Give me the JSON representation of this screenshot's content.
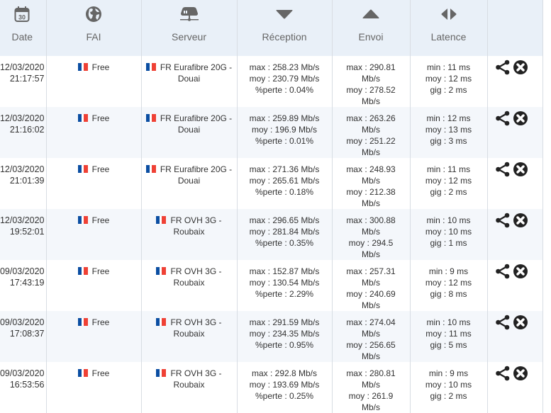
{
  "header": {
    "columns": [
      {
        "label": "Date",
        "icon": "calendar-icon",
        "icon_text": "30"
      },
      {
        "label": "FAI",
        "icon": "globe-icon"
      },
      {
        "label": "Serveur",
        "icon": "server-icon"
      },
      {
        "label": "Réception",
        "icon": "triangle-down-icon"
      },
      {
        "label": "Envoi",
        "icon": "triangle-up-icon"
      },
      {
        "label": "Latence",
        "icon": "left-right-icon"
      },
      {
        "label": "",
        "icon": ""
      }
    ]
  },
  "colors": {
    "header_bg": "#e9f0f8",
    "alt_row_bg": "#f4f7fb",
    "flag_blue": "#0b4ea2",
    "flag_red": "#ef4135"
  },
  "rows": [
    {
      "date": "12/03/2020",
      "time": "21:17:57",
      "fai": "Free",
      "server": "FR Eurafibre 20G - Douai",
      "rx_max": "max : 258.23 Mb/s",
      "rx_moy": "moy : 230.79 Mb/s",
      "rx_loss": "%perte : 0.04%",
      "tx_max": "max : 290.81 Mb/s",
      "tx_moy": "moy : 278.52 Mb/s",
      "lat_min": "min : 11 ms",
      "lat_moy": "moy : 12 ms",
      "lat_gig": "gig : 2 ms"
    },
    {
      "date": "12/03/2020",
      "time": "21:16:02",
      "fai": "Free",
      "server": "FR Eurafibre 20G - Douai",
      "rx_max": "max : 259.89 Mb/s",
      "rx_moy": "moy : 196.9 Mb/s",
      "rx_loss": "%perte : 0.01%",
      "tx_max": "max : 263.26 Mb/s",
      "tx_moy": "moy : 251.22 Mb/s",
      "lat_min": "min : 12 ms",
      "lat_moy": "moy : 13 ms",
      "lat_gig": "gig : 3 ms"
    },
    {
      "date": "12/03/2020",
      "time": "21:01:39",
      "fai": "Free",
      "server": "FR Eurafibre 20G - Douai",
      "rx_max": "max : 271.36 Mb/s",
      "rx_moy": "moy : 265.61 Mb/s",
      "rx_loss": "%perte : 0.18%",
      "tx_max": "max : 248.93 Mb/s",
      "tx_moy": "moy : 212.38 Mb/s",
      "lat_min": "min : 11 ms",
      "lat_moy": "moy : 12 ms",
      "lat_gig": "gig : 2 ms"
    },
    {
      "date": "12/03/2020",
      "time": "19:52:01",
      "fai": "Free",
      "server": "FR OVH 3G - Roubaix",
      "rx_max": "max : 296.65 Mb/s",
      "rx_moy": "moy : 281.84 Mb/s",
      "rx_loss": "%perte : 0.35%",
      "tx_max": "max : 300.88 Mb/s",
      "tx_moy": "moy : 294.5 Mb/s",
      "lat_min": "min : 10 ms",
      "lat_moy": "moy : 10 ms",
      "lat_gig": "gig : 1 ms"
    },
    {
      "date": "09/03/2020",
      "time": "17:43:19",
      "fai": "Free",
      "server": "FR OVH 3G - Roubaix",
      "rx_max": "max : 152.87 Mb/s",
      "rx_moy": "moy : 130.54 Mb/s",
      "rx_loss": "%perte : 2.29%",
      "tx_max": "max : 257.31 Mb/s",
      "tx_moy": "moy : 240.69 Mb/s",
      "lat_min": "min : 9 ms",
      "lat_moy": "moy : 12 ms",
      "lat_gig": "gig : 8 ms"
    },
    {
      "date": "09/03/2020",
      "time": "17:08:37",
      "fai": "Free",
      "server": "FR OVH 3G - Roubaix",
      "rx_max": "max : 291.59 Mb/s",
      "rx_moy": "moy : 234.35 Mb/s",
      "rx_loss": "%perte : 0.95%",
      "tx_max": "max : 274.04 Mb/s",
      "tx_moy": "moy : 256.65 Mb/s",
      "lat_min": "min : 10 ms",
      "lat_moy": "moy : 11 ms",
      "lat_gig": "gig : 5 ms"
    },
    {
      "date": "09/03/2020",
      "time": "16:53:56",
      "fai": "Free",
      "server": "FR OVH 3G - Roubaix",
      "rx_max": "max : 292.8 Mb/s",
      "rx_moy": "moy : 193.69 Mb/s",
      "rx_loss": "%perte : 0.25%",
      "tx_max": "max : 280.81 Mb/s",
      "tx_moy": "moy : 261.9 Mb/s",
      "lat_min": "min : 9 ms",
      "lat_moy": "moy : 10 ms",
      "lat_gig": "gig : 2 ms"
    }
  ]
}
